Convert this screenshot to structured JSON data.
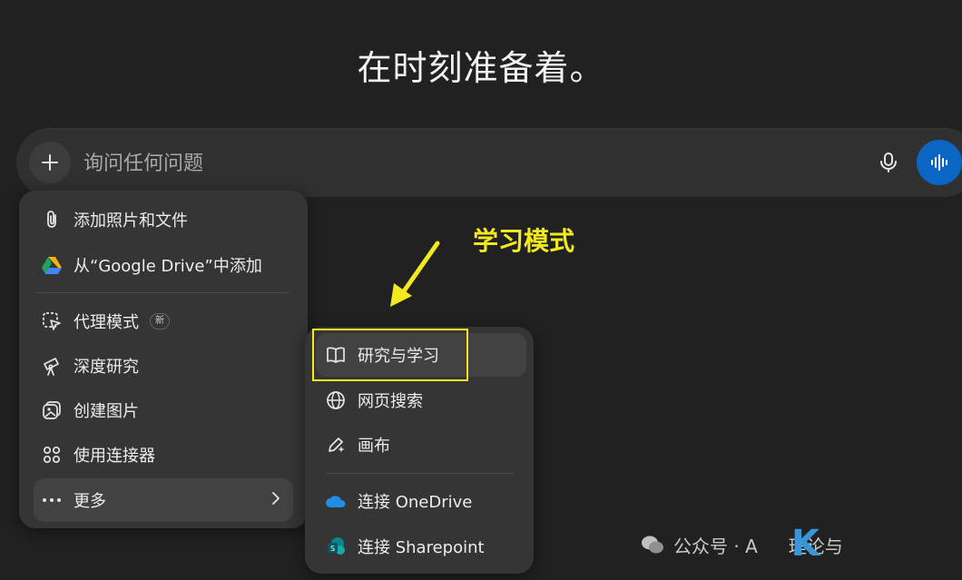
{
  "headline": "在时刻准备着。",
  "composer": {
    "placeholder": "询问任何问题",
    "plus_icon": "plus-icon",
    "mic_icon": "microphone-icon",
    "voice_icon": "voice-waveform-icon",
    "voice_color": "#0b66c3"
  },
  "main_menu": {
    "items": [
      {
        "label": "添加照片和文件",
        "icon": "paperclip-icon"
      },
      {
        "label": "从“Google Drive”中添加",
        "icon": "google-drive-icon"
      },
      {
        "label": "代理模式",
        "icon": "agent-cursor-icon",
        "badge": "新"
      },
      {
        "label": "深度研究",
        "icon": "telescope-icon"
      },
      {
        "label": "创建图片",
        "icon": "image-icon"
      },
      {
        "label": "使用连接器",
        "icon": "connectors-icon"
      },
      {
        "label": "更多",
        "icon": "more-dots-icon",
        "chevron": "chevron-right-icon"
      }
    ]
  },
  "sub_menu": {
    "items": [
      {
        "label": "研究与学习",
        "icon": "book-icon"
      },
      {
        "label": "网页搜索",
        "icon": "globe-icon"
      },
      {
        "label": "画布",
        "icon": "pen-icon"
      },
      {
        "label": "连接 OneDrive",
        "icon": "onedrive-icon"
      },
      {
        "label": "连接 Sharepoint",
        "icon": "sharepoint-icon"
      }
    ]
  },
  "annotation": {
    "text": "学习模式",
    "color": "#f2ea1e"
  },
  "watermark": {
    "text": "公众号 · A",
    "brand_mark": "K",
    "brand_text": "理论与"
  }
}
